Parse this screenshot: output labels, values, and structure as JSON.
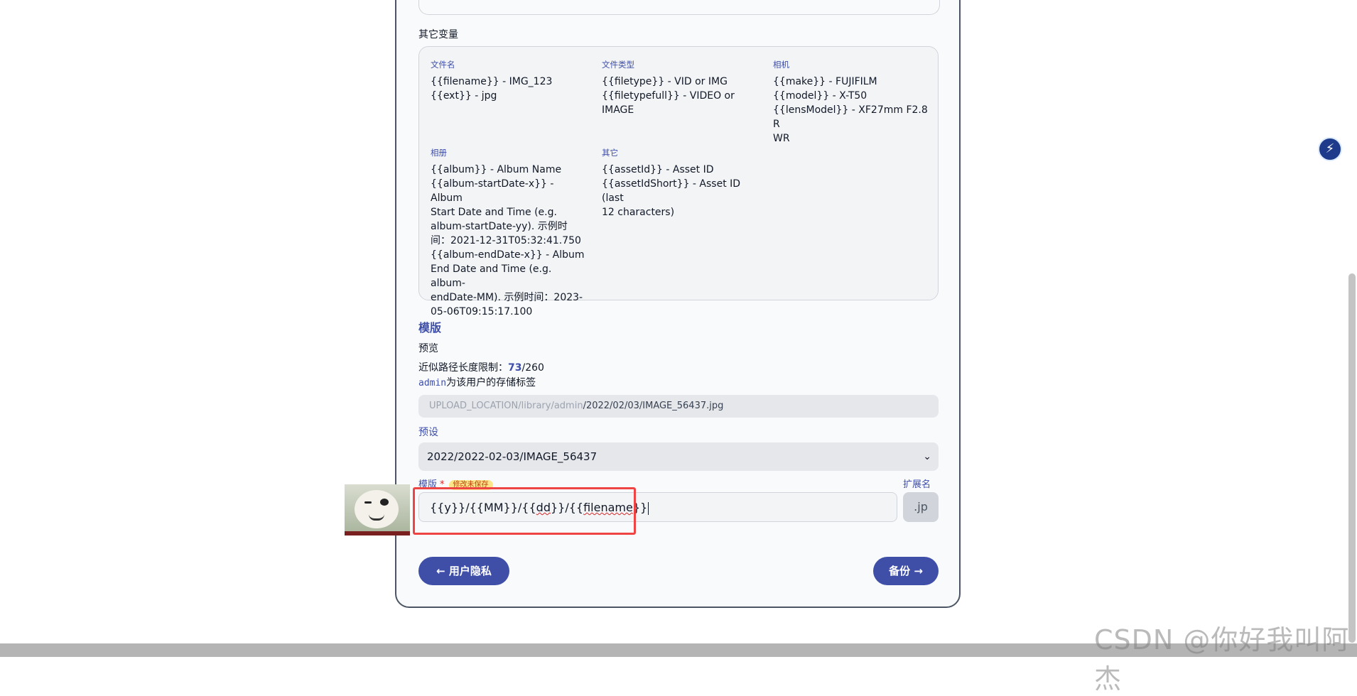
{
  "other_vars": {
    "title": "其它变量",
    "groups": [
      {
        "header": "文件名",
        "lines": [
          "{{filename}} - IMG_123",
          "{{ext}} - jpg"
        ]
      },
      {
        "header": "文件类型",
        "lines": [
          "{{filetype}} - VID or IMG",
          "{{filetypefull}} - VIDEO or",
          "IMAGE"
        ]
      },
      {
        "header": "相机",
        "lines": [
          "{{make}} - FUJIFILM",
          "{{model}} - X-T50",
          "{{lensModel}} - XF27mm F2.8 R",
          "WR"
        ]
      },
      {
        "header": "相册",
        "lines": [
          "{{album}} - Album Name",
          "{{album-startDate-x}} - Album",
          "Start Date and Time (e.g.",
          "album-startDate-yy). 示例时",
          "间：2021-12-31T05:32:41.750",
          "{{album-endDate-x}} - Album",
          "End Date and Time (e.g. album-",
          "endDate-MM). 示例时间：2023-",
          "05-06T09:15:17.100"
        ]
      },
      {
        "header": "其它",
        "lines": [
          "{{assetId}} - Asset ID",
          "{{assetIdShort}} - Asset ID (last",
          "12 characters)"
        ]
      }
    ]
  },
  "template": {
    "title": "模版",
    "preview_label": "预览",
    "limit_prefix": "近似路径长度限制：",
    "limit_value": "73",
    "limit_total": "/260",
    "storage_user": "admin",
    "storage_suffix": "为该用户的存储标签",
    "path_grey": "UPLOAD_LOCATION/library/admin",
    "path_dark": "/2022/02/03/IMAGE_56437.jpg",
    "preset_label": "预设",
    "preset_value": "2022/2022-02-03/IMAGE_56437",
    "template_label": "模版",
    "required_star": "*",
    "unsaved_badge": "修改未保存",
    "ext_label": "扩展名",
    "input_parts": [
      "{{y}}/{{MM}}/{{",
      "dd",
      "}}/{{",
      "filename",
      "}}"
    ],
    "ext_value": ".jp"
  },
  "buttons": {
    "back": "←  用户隐私",
    "next": "备份 →"
  },
  "watermark": "CSDN @你好我叫阿杰",
  "colors": {
    "accent": "#3f4fa8",
    "highlight": "#ef4444"
  }
}
